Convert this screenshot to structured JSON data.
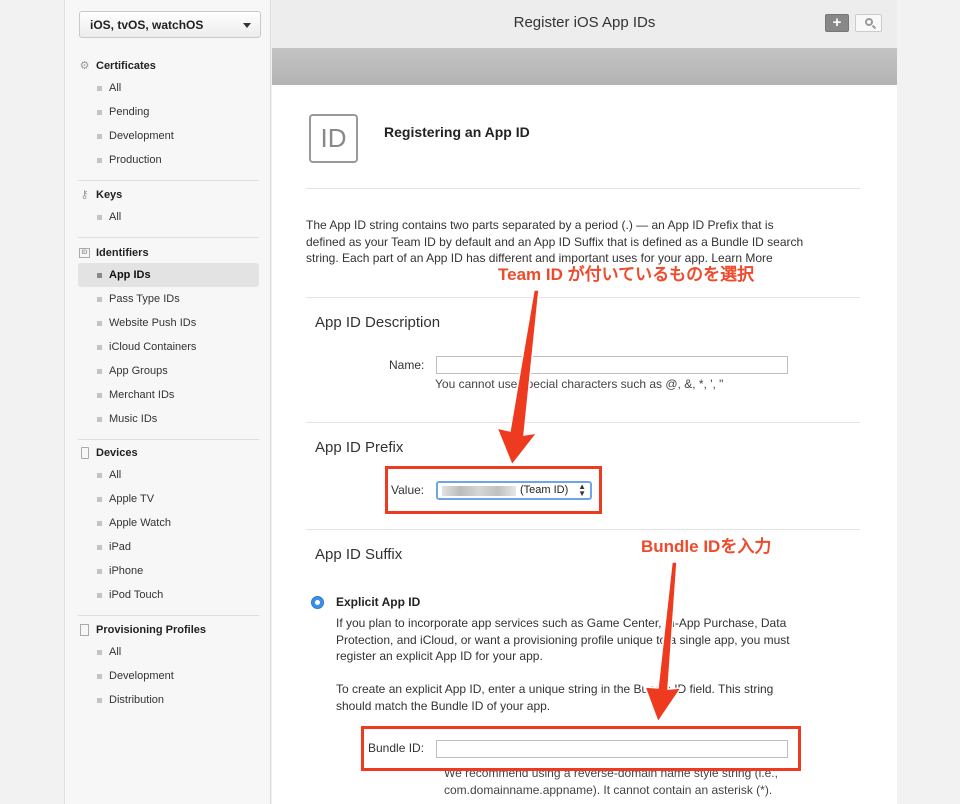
{
  "sidebar": {
    "platform": "iOS, tvOS, watchOS",
    "sections": [
      {
        "title": "Certificates",
        "items": [
          "All",
          "Pending",
          "Development",
          "Production"
        ]
      },
      {
        "title": "Keys",
        "items": [
          "All"
        ]
      },
      {
        "title": "Identifiers",
        "items": [
          "App IDs",
          "Pass Type IDs",
          "Website Push IDs",
          "iCloud Containers",
          "App Groups",
          "Merchant IDs",
          "Music IDs"
        ]
      },
      {
        "title": "Devices",
        "items": [
          "All",
          "Apple TV",
          "Apple Watch",
          "iPad",
          "iPhone",
          "iPod Touch"
        ]
      },
      {
        "title": "Provisioning Profiles",
        "items": [
          "All",
          "Development",
          "Distribution"
        ]
      }
    ],
    "active_item": "App IDs"
  },
  "header": {
    "title": "Register iOS App IDs",
    "add_label": "+"
  },
  "main": {
    "icon_text": "ID",
    "heading": "Registering an App ID",
    "intro_lines": [
      "The App ID string contains two parts separated by a period (.) — an App ID Prefix that is",
      "defined as your Team ID by default and an App ID Suffix that is defined as a Bundle ID search",
      "string. Each part of an App ID has different and important uses for your app. Learn More"
    ],
    "description": {
      "heading": "App ID Description",
      "name_label": "Name:",
      "name_value": "",
      "hint": "You cannot use special characters such as @, &, *, ', \""
    },
    "prefix": {
      "heading": "App ID Prefix",
      "value_label": "Value:",
      "selected_value": "(Team ID)"
    },
    "suffix": {
      "heading": "App ID Suffix",
      "explicit_label": "Explicit App ID",
      "explicit_selected": true,
      "para1_lines": [
        "If you plan to incorporate app services such as Game Center, In-App Purchase, Data",
        "Protection, and iCloud, or want a provisioning profile unique to a single app, you must",
        "register an explicit App ID for your app."
      ],
      "para2_lines": [
        "To create an explicit App ID, enter a unique string in the Bundle ID field. This string",
        "should match the Bundle ID of your app."
      ],
      "bundle_label": "Bundle ID:",
      "bundle_value": "",
      "bundle_hint_lines": [
        "We recommend using a reverse-domain name style string (i.e.,",
        "com.domainname.appname). It cannot contain an asterisk (*)."
      ]
    }
  },
  "annotations": {
    "team_callout": "Team ID が付いているものを選択",
    "bundle_callout": "Bundle IDを入力",
    "color": "#ee3a1e"
  },
  "icons": [
    "gear-icon",
    "key-icon",
    "id-card-icon",
    "device-icon",
    "document-icon",
    "search-icon",
    "plus-icon",
    "chevron-down-icon"
  ]
}
